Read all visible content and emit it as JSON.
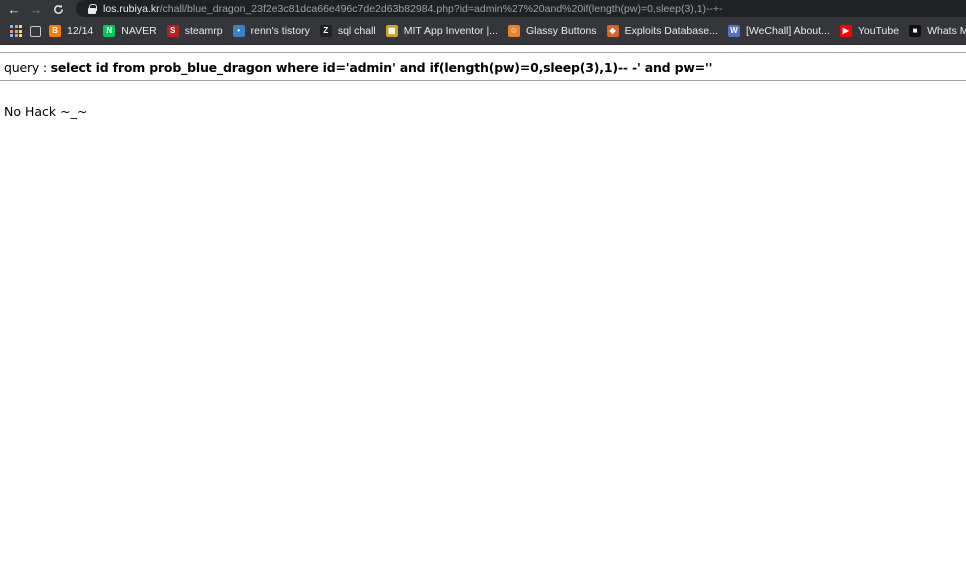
{
  "browser": {
    "url_host": "los.rubiya.kr",
    "url_path": "/chall/blue_dragon_23f2e3c81dca66e496c7de2d63b82984.php?id=admin%27%20and%20if(length(pw)=0,sleep(3),1)--+-"
  },
  "bookmarks": [
    {
      "label": "12/14",
      "icon": "blogger-icon",
      "color": "#f57d00",
      "glyph": "B"
    },
    {
      "label": "NAVER",
      "icon": "naver-icon",
      "color": "#03c75a",
      "glyph": "N"
    },
    {
      "label": "steamrp",
      "icon": "steamrp-icon",
      "color": "#b22222",
      "glyph": "S"
    },
    {
      "label": "renn's tistory",
      "icon": "tistory-icon",
      "color": "#3b82c4",
      "glyph": "•"
    },
    {
      "label": "sql chall",
      "icon": "z-icon",
      "color": "#202124",
      "glyph": "Z"
    },
    {
      "label": "MIT App Inventor |...",
      "icon": "app-inventor-icon",
      "color": "#c9a227",
      "glyph": "▦"
    },
    {
      "label": "Glassy Buttons",
      "icon": "glassy-buttons-icon",
      "color": "#e8832a",
      "glyph": "☺"
    },
    {
      "label": "Exploits Database...",
      "icon": "exploit-db-icon",
      "color": "#d9622b",
      "glyph": "◆"
    },
    {
      "label": "[WeChall] About...",
      "icon": "wechall-icon",
      "color": "#5470c6",
      "glyph": "W"
    },
    {
      "label": "YouTube",
      "icon": "youtube-icon",
      "color": "#ff0000",
      "glyph": "▶"
    },
    {
      "label": "Whats My IP Addr...",
      "icon": "whatsmyip-icon",
      "color": "#111111",
      "glyph": "■"
    }
  ],
  "page": {
    "query_label": "query : ",
    "query_sql": "select id from prob_blue_dragon where id='admin' and if(length(pw)=0,sleep(3),1)-- -' and pw=''",
    "message": "No Hack ~_~"
  }
}
